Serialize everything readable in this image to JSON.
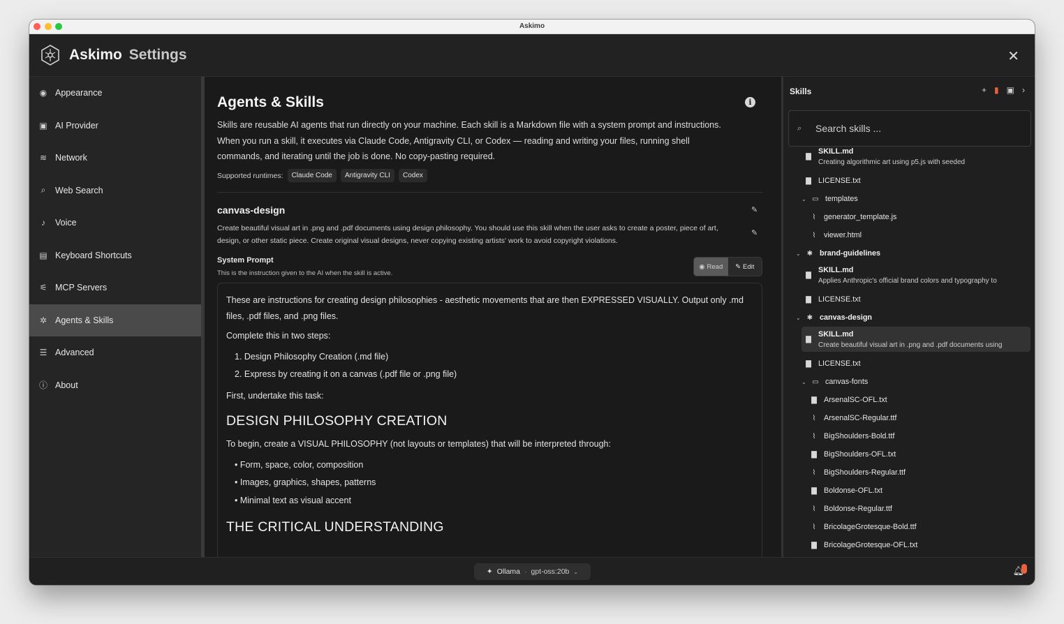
{
  "window": {
    "title": "Askimo"
  },
  "header": {
    "app_name": "Askimo",
    "section": "Settings",
    "close_icon": "close-icon"
  },
  "sidebar": {
    "items": [
      {
        "label": "Appearance",
        "icon": "palette-icon",
        "glyph": "◉"
      },
      {
        "label": "AI Provider",
        "icon": "robot-icon",
        "glyph": "▣"
      },
      {
        "label": "Network",
        "icon": "wifi-icon",
        "glyph": "≋"
      },
      {
        "label": "Web Search",
        "icon": "search-icon",
        "glyph": "⌕"
      },
      {
        "label": "Voice",
        "icon": "microphone-icon",
        "glyph": "♪"
      },
      {
        "label": "Keyboard Shortcuts",
        "icon": "keyboard-icon",
        "glyph": "▤"
      },
      {
        "label": "MCP Servers",
        "icon": "plug-icon",
        "glyph": "⚟"
      },
      {
        "label": "Agents & Skills",
        "icon": "agents-icon",
        "glyph": "✲",
        "active": true
      },
      {
        "label": "Advanced",
        "icon": "sliders-icon",
        "glyph": "☰"
      },
      {
        "label": "About",
        "icon": "info-icon",
        "glyph": "ⓘ"
      }
    ]
  },
  "main": {
    "title": "Agents & Skills",
    "description": "Skills are reusable AI agents that run directly on your machine. Each skill is a Markdown file with a system prompt and instructions. When you run a skill, it executes via Claude Code, Antigravity CLI, or Codex — reading and writing your files, running shell commands, and iterating until the job is done. No copy-pasting required.",
    "runtimes_label": "Supported runtimes:",
    "runtimes": [
      "Claude Code",
      "Antigravity CLI",
      "Codex"
    ],
    "skill": {
      "name": "canvas-design",
      "description": "Create beautiful visual art in .png and .pdf documents using design philosophy. You should use this skill when the user asks to create a poster, piece of art, design, or other static piece. Create original visual designs, never copying existing artists' work to avoid copyright violations."
    },
    "system_prompt": {
      "label": "System Prompt",
      "subtitle": "This is the instruction given to the AI when the skill is active.",
      "read_label": "Read",
      "edit_label": "Edit",
      "intro": "These are instructions for creating design philosophies - aesthetic movements that are then EXPRESSED VISUALLY. Output only .md files, .pdf files, and .png files.",
      "steps_intro": "Complete this in two steps:",
      "steps": [
        "1. Design Philosophy Creation (.md file)",
        "2. Express by creating it on a canvas (.pdf file or .png file)"
      ],
      "task_intro": "First, undertake this task:",
      "heading1": "DESIGN PHILOSOPHY CREATION",
      "para1": "To begin, create a VISUAL PHILOSOPHY (not layouts or templates) that will be interpreted through:",
      "bullets": [
        "• Form, space, color, composition",
        "• Images, graphics, shapes, patterns",
        "• Minimal text as visual accent"
      ],
      "heading2": "THE CRITICAL UNDERSTANDING"
    }
  },
  "skills_panel": {
    "title": "Skills",
    "search_placeholder": "Search skills ...",
    "tree": [
      {
        "kind": "file2",
        "name": "SKILL.md",
        "sub": "Creating algorithmic art using p5.js with seeded",
        "indent": 1,
        "icon": "document-icon"
      },
      {
        "kind": "file",
        "name": "LICENSE.txt",
        "indent": 1,
        "icon": "document-icon"
      },
      {
        "kind": "folder",
        "name": "templates",
        "indent": 1,
        "icon": "folder-icon"
      },
      {
        "kind": "file",
        "name": "generator_template.js",
        "indent": 2,
        "icon": "paperclip-icon"
      },
      {
        "kind": "file",
        "name": "viewer.html",
        "indent": 2,
        "icon": "paperclip-icon"
      },
      {
        "kind": "skill",
        "name": "brand-guidelines",
        "indent": 0,
        "icon": "star-icon"
      },
      {
        "kind": "file2",
        "name": "SKILL.md",
        "sub": "Applies Anthropic's official brand colors and typography to",
        "indent": 1,
        "icon": "document-icon"
      },
      {
        "kind": "file",
        "name": "LICENSE.txt",
        "indent": 1,
        "icon": "document-icon"
      },
      {
        "kind": "skill",
        "name": "canvas-design",
        "indent": 0,
        "icon": "star-icon"
      },
      {
        "kind": "file2",
        "name": "SKILL.md",
        "sub": "Create beautiful visual art in .png and .pdf documents using",
        "indent": 1,
        "icon": "document-icon",
        "selected": true
      },
      {
        "kind": "file",
        "name": "LICENSE.txt",
        "indent": 1,
        "icon": "document-icon"
      },
      {
        "kind": "folder",
        "name": "canvas-fonts",
        "indent": 1,
        "icon": "folder-icon"
      },
      {
        "kind": "file",
        "name": "ArsenalSC-OFL.txt",
        "indent": 2,
        "icon": "document-icon"
      },
      {
        "kind": "file",
        "name": "ArsenalSC-Regular.ttf",
        "indent": 2,
        "icon": "paperclip-icon"
      },
      {
        "kind": "file",
        "name": "BigShoulders-Bold.ttf",
        "indent": 2,
        "icon": "paperclip-icon"
      },
      {
        "kind": "file",
        "name": "BigShoulders-OFL.txt",
        "indent": 2,
        "icon": "document-icon"
      },
      {
        "kind": "file",
        "name": "BigShoulders-Regular.ttf",
        "indent": 2,
        "icon": "paperclip-icon"
      },
      {
        "kind": "file",
        "name": "Boldonse-OFL.txt",
        "indent": 2,
        "icon": "document-icon"
      },
      {
        "kind": "file",
        "name": "Boldonse-Regular.ttf",
        "indent": 2,
        "icon": "paperclip-icon"
      },
      {
        "kind": "file",
        "name": "BricolageGrotesque-Bold.ttf",
        "indent": 2,
        "icon": "paperclip-icon"
      },
      {
        "kind": "file",
        "name": "BricolageGrotesque-OFL.txt",
        "indent": 2,
        "icon": "document-icon"
      }
    ]
  },
  "footer": {
    "provider": "Ollama",
    "separator": "·",
    "model": "gpt-oss:20b"
  },
  "colors": {
    "background": "#1b1b1b",
    "sidebar_active": "#4a4a4a",
    "notification": "#e8603c"
  }
}
